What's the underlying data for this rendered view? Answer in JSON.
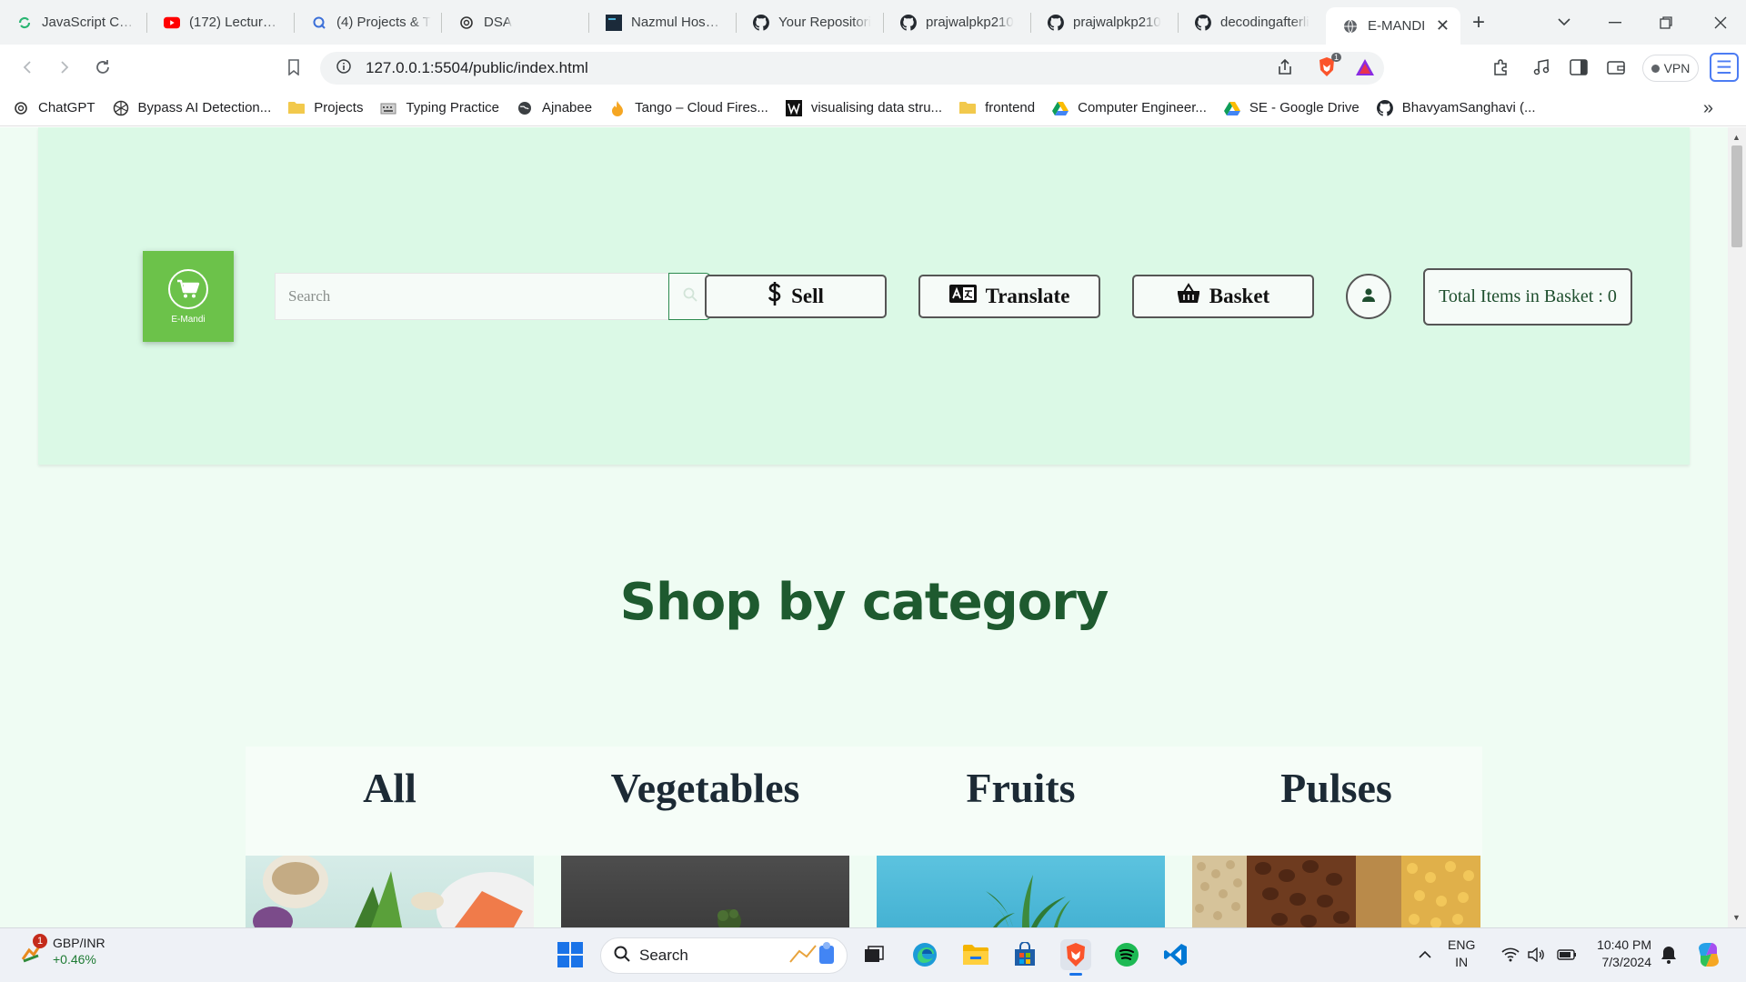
{
  "browser": {
    "tabs": [
      {
        "title": "JavaScript Chea",
        "icon": "codewars-icon",
        "active": false
      },
      {
        "title": "(172) Lecture22",
        "icon": "youtube-icon",
        "active": false
      },
      {
        "title": "(4) Projects & T",
        "icon": "quora-icon",
        "active": false
      },
      {
        "title": "DSA",
        "icon": "openai-icon",
        "active": false
      },
      {
        "title": "Nazmul Hossain",
        "icon": "portfolio-icon",
        "active": false
      },
      {
        "title": "Your Repositori",
        "icon": "github-icon",
        "active": false
      },
      {
        "title": "prajwalpkp210",
        "icon": "github-icon",
        "active": false
      },
      {
        "title": "prajwalpkp210",
        "icon": "github-icon",
        "active": false
      },
      {
        "title": "decodingafterli",
        "icon": "github-icon",
        "active": false
      },
      {
        "title": "E-MANDI",
        "icon": "globe-icon",
        "active": true
      }
    ],
    "url": "127.0.0.1:5504/public/index.html",
    "vpn_label": "VPN",
    "brave_badge": "1",
    "bookmarks": [
      {
        "label": "ChatGPT",
        "icon": "openai-icon"
      },
      {
        "label": "Bypass AI Detection...",
        "icon": "aperture-icon"
      },
      {
        "label": "Projects",
        "icon": "folder-icon"
      },
      {
        "label": "Typing Practice",
        "icon": "keyboard-icon"
      },
      {
        "label": "Ajnabee",
        "icon": "globe-dark-icon"
      },
      {
        "label": "Tango – Cloud Fires...",
        "icon": "flame-icon"
      },
      {
        "label": "visualising data stru...",
        "icon": "visualgo-icon"
      },
      {
        "label": "frontend",
        "icon": "folder-icon"
      },
      {
        "label": "Computer Engineer...",
        "icon": "drive-icon"
      },
      {
        "label": "SE - Google Drive",
        "icon": "drive-icon"
      },
      {
        "label": "BhavyamSanghavi (...",
        "icon": "github-icon"
      }
    ]
  },
  "page": {
    "logo_text": "E-Mandi",
    "search_placeholder": "Search",
    "buttons": {
      "sell": "Sell",
      "translate": "Translate",
      "basket": "Basket"
    },
    "basket_total": "Total Items in Basket : 0",
    "section_title": "Shop by category",
    "categories": [
      {
        "label": "All"
      },
      {
        "label": "Vegetables"
      },
      {
        "label": "Fruits"
      },
      {
        "label": "Pulses"
      }
    ]
  },
  "taskbar": {
    "ticker_pair": "GBP/INR",
    "ticker_change": "+0.46%",
    "ticker_badge": "1",
    "search_label": "Search",
    "lang_line1": "ENG",
    "lang_line2": "IN",
    "time": "10:40 PM",
    "date": "7/3/2024"
  },
  "colors": {
    "header_bg": "#dbf9e6",
    "page_bg": "#effcf3",
    "logo_bg": "#6cc24a",
    "title_color": "#1e5a2f"
  }
}
